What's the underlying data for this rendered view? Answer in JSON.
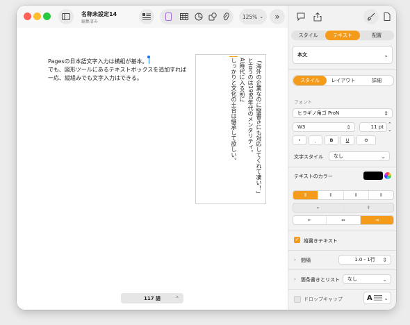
{
  "window": {
    "title": "名称未設定14",
    "subtitle": "編集済み"
  },
  "toolbar": {
    "zoom": "125%",
    "more": "»"
  },
  "document": {
    "body_lines": [
      "Pagesの日本語文字入力は横組が基本。",
      "でも、図形ツールにあるテキストボックスを追加すれば",
      "一応、縦組みでも文字入力はできる。"
    ],
    "vertical_lines": [
      "「海外の企業なのに縦書きにも対応してくれて凄い！」",
      "と言うのは1990年代のメンタリティ。",
      "AI時代に入る前に",
      "しっかりと文化の土台は継承して欲しい。"
    ],
    "word_count": "117 語"
  },
  "inspector": {
    "tabs": [
      "スタイル",
      "テキスト",
      "配置"
    ],
    "active_tab": 1,
    "paragraph_style": "本文",
    "subtabs": [
      "スタイル",
      "レイアウト",
      "詳細"
    ],
    "active_subtab": 0,
    "font_label": "フォント",
    "font_name": "ヒラギノ角ゴ ProN",
    "font_weight": "W3",
    "font_size": "11 pt",
    "format_buttons": [
      "•",
      "ˎ",
      "B",
      "U",
      "⚙"
    ],
    "char_style_label": "文字スタイル",
    "char_style_value": "なし",
    "color_label": "テキストのカラー",
    "text_color": "#000000",
    "accent": "#f59b1b",
    "vertical_text_label": "縦書きテキスト",
    "vertical_text_checked": true,
    "spacing_label": "間隔",
    "spacing_value": "1.0 - 1行",
    "bullets_label": "箇条書きとリスト",
    "bullets_value": "なし",
    "dropcap_label": "ドロップキャップ"
  }
}
